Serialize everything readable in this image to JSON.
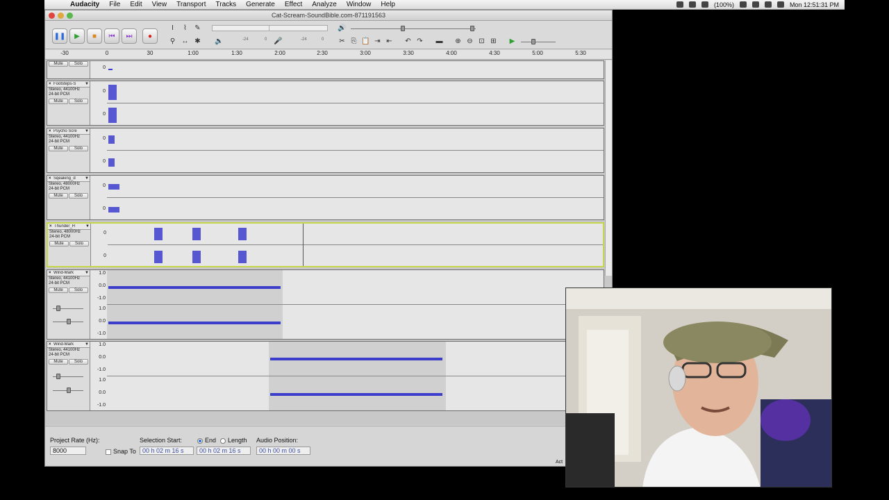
{
  "menubar": {
    "app": "Audacity",
    "items": [
      "File",
      "Edit",
      "View",
      "Transport",
      "Tracks",
      "Generate",
      "Effect",
      "Analyze",
      "Window",
      "Help"
    ],
    "battery": "(100%)",
    "clock": "Mon 12:51:31 PM"
  },
  "window": {
    "title": "Cat-Scream-SoundBible.com-871191563"
  },
  "meters": {
    "rec_lo": "-24",
    "rec_hi": "0",
    "play_lo": "-24",
    "play_hi": "0"
  },
  "ruler": {
    "ticks": [
      "-30",
      "0",
      "30",
      "1:00",
      "1:30",
      "2:00",
      "2:30",
      "3:00",
      "3:30",
      "4:00",
      "4:30",
      "5:00",
      "5:30"
    ]
  },
  "tracks": [
    {
      "name": "",
      "meta": [],
      "scale": [
        "0"
      ],
      "mute": "Mute",
      "solo": "Solo"
    },
    {
      "name": "Footsteps-S",
      "meta": [
        "Stereo, 44100Hz",
        "24-bit PCM"
      ],
      "scale": [
        "0",
        "0"
      ],
      "mute": "Mute",
      "solo": "Solo"
    },
    {
      "name": "Psycho Scre",
      "meta": [
        "Stereo, 44100Hz",
        "24-bit PCM"
      ],
      "scale": [
        "0",
        "0"
      ],
      "mute": "Mute",
      "solo": "Solo"
    },
    {
      "name": "Sqeaking_d",
      "meta": [
        "Stereo, 48000Hz",
        "24-bit PCM"
      ],
      "scale": [
        "0",
        "0"
      ],
      "mute": "Mute",
      "solo": "Solo"
    },
    {
      "name": "Thunder_H",
      "meta": [
        "Stereo, 48000Hz",
        "24-bit PCM"
      ],
      "scale": [
        "0",
        "0"
      ],
      "mute": "Mute",
      "solo": "Solo"
    },
    {
      "name": "Wind-Mark",
      "meta": [
        "Stereo, 44100Hz",
        "24-bit PCM"
      ],
      "scale": [
        "1.0",
        "0.0",
        "-1.0",
        "1.0",
        "0.0",
        "-1.0"
      ],
      "mute": "Mute",
      "solo": "Solo"
    },
    {
      "name": "Wind-Mark",
      "meta": [
        "Stereo, 44100Hz",
        "24-bit PCM"
      ],
      "scale": [
        "1.0",
        "0.0",
        "-1.0",
        "1.0",
        "0.0",
        "-1.0"
      ],
      "mute": "Mute",
      "solo": "Solo"
    }
  ],
  "selection_bar": {
    "project_rate_label": "Project Rate (Hz):",
    "project_rate_value": "8000",
    "snap_to": "Snap To",
    "selection_start_label": "Selection Start:",
    "end_label": "End",
    "length_label": "Length",
    "audio_position_label": "Audio Position:",
    "selection_start": "00 h 02 m 16 s",
    "end_value": "00 h 02 m 16 s",
    "audio_position": "00 h 00 m 00 s",
    "status_tail": "Act"
  },
  "colors": {
    "waveform": "#3d3dcc",
    "selected_border": "#c6d64a"
  }
}
